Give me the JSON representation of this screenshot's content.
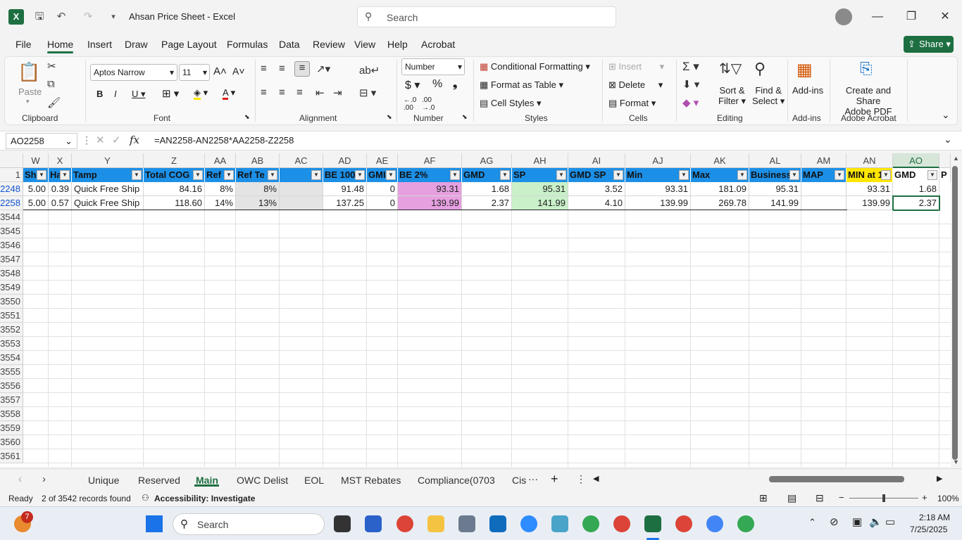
{
  "titlebar": {
    "app_letter": "X",
    "doc_title": "Ahsan Price Sheet  -  Excel",
    "search_placeholder": "Search"
  },
  "menu": {
    "tabs": [
      "File",
      "Home",
      "Insert",
      "Draw",
      "Page Layout",
      "Formulas",
      "Data",
      "Review",
      "View",
      "Help",
      "Acrobat"
    ],
    "share_label": "Share"
  },
  "ribbon": {
    "clipboard": {
      "paste": "Paste",
      "group": "Clipboard"
    },
    "font": {
      "name": "Aptos Narrow",
      "size": "11",
      "group": "Font"
    },
    "alignment": {
      "group": "Alignment"
    },
    "number": {
      "format": "Number",
      "group": "Number"
    },
    "styles": {
      "conditional": "Conditional Formatting",
      "table": "Format as Table",
      "cell_styles": "Cell Styles",
      "group": "Styles"
    },
    "cells": {
      "insert": "Insert",
      "delete": "Delete",
      "format": "Format",
      "group": "Cells"
    },
    "editing": {
      "sort": "Sort &",
      "filter": "Filter",
      "find": "Find &",
      "select": "Select",
      "group": "Editing"
    },
    "addins": {
      "label": "Add-ins",
      "group": "Add-ins"
    },
    "acrobat": {
      "line1": "Create and Share",
      "line2": "Adobe PDF",
      "group": "Adobe Acrobat"
    }
  },
  "formula_bar": {
    "name_box": "AO2258",
    "formula": "=AN2258-AN2258*AA2258-Z2258"
  },
  "grid": {
    "columns": [
      "W",
      "X",
      "Y",
      "Z",
      "AA",
      "AB",
      "AC",
      "AD",
      "AE",
      "AF",
      "AG",
      "AH",
      "AI",
      "AJ",
      "AK",
      "AL",
      "AM",
      "AN",
      "AO"
    ],
    "headers": [
      "Sh",
      "Ha",
      "Tamp",
      "Total COG",
      "Ref",
      "Ref Te",
      "",
      "BE 100",
      "GMI",
      "BE 2%",
      "GMD",
      "SP",
      "GMD SP",
      "Min",
      "Max",
      "Business",
      "MAP",
      "MIN at 1",
      "GMD",
      "P"
    ],
    "rows": [
      {
        "num": "2248",
        "cells": [
          "5.00",
          "0.39",
          "Quick Free Ship",
          "84.16",
          "8%",
          "8%",
          "",
          "91.48",
          "0",
          "93.31",
          "1.68",
          "95.31",
          "3.52",
          "93.31",
          "181.09",
          "95.31",
          "",
          "93.31",
          "1.68"
        ]
      },
      {
        "num": "2258",
        "cells": [
          "5.00",
          "0.57",
          "Quick Free Ship",
          "118.60",
          "14%",
          "13%",
          "",
          "137.25",
          "0",
          "139.99",
          "2.37",
          "141.99",
          "4.10",
          "139.99",
          "269.78",
          "141.99",
          "",
          "139.99",
          "2.37"
        ]
      }
    ],
    "empty_rows": [
      "3544",
      "3545",
      "3546",
      "3547",
      "3548",
      "3549",
      "3550",
      "3551",
      "3552",
      "3553",
      "3554",
      "3555",
      "3556",
      "3557",
      "3558",
      "3559",
      "3560",
      "3561"
    ],
    "header_row": "1"
  },
  "sheets": {
    "tabs": [
      "Unique",
      "Reserved",
      "Main",
      "OWC Delist",
      "EOL",
      "MST Rebates",
      "Compliance(0703",
      "Cis"
    ],
    "active": "Main"
  },
  "status": {
    "ready": "Ready",
    "records": "2 of 3542 records found",
    "accessibility": "Accessibility: Investigate",
    "zoom": "100%"
  },
  "taskbar": {
    "badge": "7",
    "search": "Search",
    "time": "2:18 AM",
    "date": "7/25/2025"
  }
}
